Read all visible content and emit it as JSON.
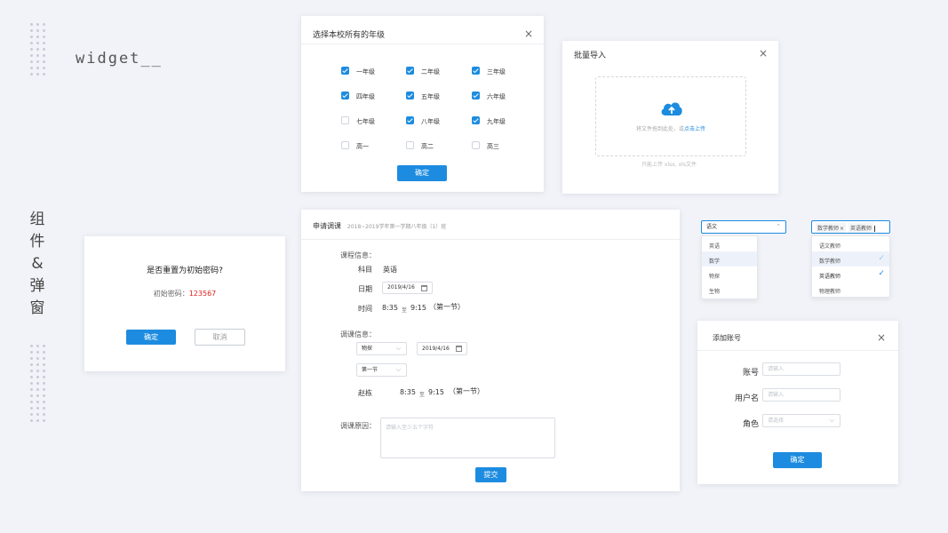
{
  "decor": {
    "widget_title": "widget__",
    "side_title": [
      "组",
      "件",
      "&",
      "弹",
      "窗"
    ]
  },
  "grade_dialog": {
    "title": "选择本校所有的年级",
    "grades": [
      {
        "label": "一年级",
        "checked": true
      },
      {
        "label": "二年级",
        "checked": true
      },
      {
        "label": "三年级",
        "checked": true
      },
      {
        "label": "四年级",
        "checked": true
      },
      {
        "label": "五年级",
        "checked": true
      },
      {
        "label": "六年级",
        "checked": true
      },
      {
        "label": "七年级",
        "checked": false
      },
      {
        "label": "八年级",
        "checked": true
      },
      {
        "label": "九年级",
        "checked": true
      },
      {
        "label": "高一",
        "checked": false
      },
      {
        "label": "高二",
        "checked": false
      },
      {
        "label": "高三",
        "checked": false
      }
    ],
    "confirm": "确定"
  },
  "import_dialog": {
    "title": "批量导入",
    "drop_text": "将文件拖到此处，或",
    "upload_link": "点击上传",
    "hint": "只能上传 xlsx, xls文件",
    "icon": "cloud-upload-icon",
    "accent": "#1d8ce0"
  },
  "reset_dialog": {
    "question": "是否重置为初始密码?",
    "password_label": "初始密码：",
    "password": "123567",
    "password_color": "#e02020",
    "confirm": "确定",
    "cancel": "取消"
  },
  "course_dialog": {
    "title": "申请调课",
    "subtitle": "2018~2019学年第一学期八年级（1）班",
    "course_info_label": "课程信息：",
    "subject_label": "科目",
    "subject": "英语",
    "date_label": "日期",
    "date": "2019/4/16",
    "time_label": "时间",
    "time_start": "8:35",
    "time_to": "至",
    "time_end": "9:15",
    "period": "（第一节）",
    "adjust_info_label": "调课信息：",
    "adjust_subject": "物探",
    "adjust_date": "2019/4/16",
    "adjust_period": "第一节",
    "teacher": "赵栋",
    "adjust_start": "8:35",
    "adjust_to": "至",
    "adjust_end": "9:15",
    "adjust_period_text": "（第一节）",
    "reason_label": "调课原因：",
    "reason_placeholder": "请输入至少五个字符",
    "submit": "提交"
  },
  "select_single": {
    "value": "语文",
    "options": [
      {
        "label": "英语",
        "highlighted": false
      },
      {
        "label": "数学",
        "highlighted": true
      },
      {
        "label": "物探",
        "highlighted": false
      },
      {
        "label": "生物",
        "highlighted": false
      }
    ]
  },
  "select_multi": {
    "tags": [
      {
        "label": "数学教师",
        "removable": true
      },
      {
        "label": "英语教师",
        "removable": false
      }
    ],
    "options": [
      {
        "label": "语文教师",
        "highlighted": false,
        "selected": false
      },
      {
        "label": "数学教师",
        "highlighted": true,
        "selected": true
      },
      {
        "label": "英语教师",
        "highlighted": false,
        "selected": true
      },
      {
        "label": "物理教师",
        "highlighted": false,
        "selected": false
      }
    ]
  },
  "account_dialog": {
    "title": "添加账号",
    "account_label": "账号",
    "account_placeholder": "请输入",
    "username_label": "用户名",
    "username_placeholder": "请输入",
    "role_label": "角色",
    "role_placeholder": "请选择",
    "confirm": "确定"
  }
}
